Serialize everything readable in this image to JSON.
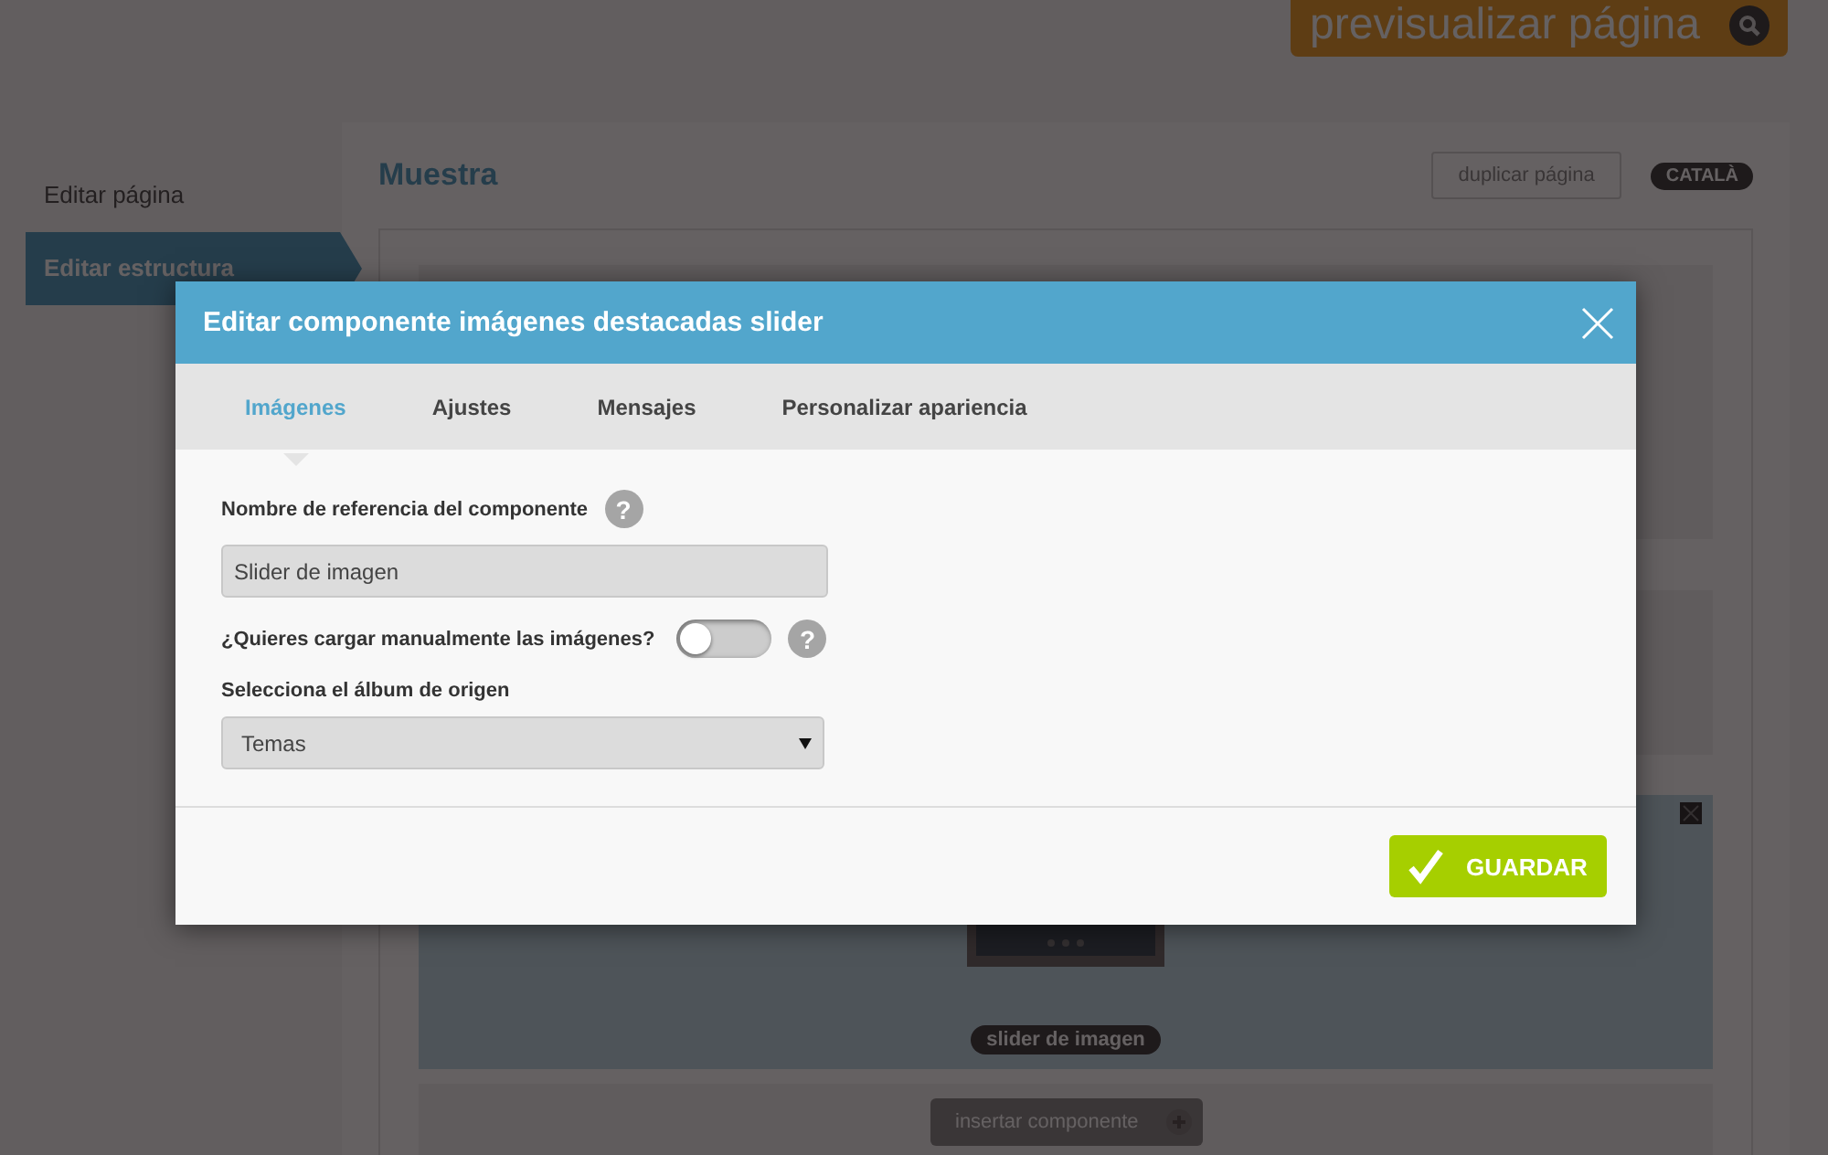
{
  "header": {
    "preview_button": "previsualizar página"
  },
  "sidebar": {
    "items": [
      {
        "label": "Editar página",
        "selected": false
      },
      {
        "label": "Editar estructura",
        "selected": true
      }
    ]
  },
  "page": {
    "title": "Muestra",
    "duplicate_button": "duplicar página",
    "language_badge": "CATALÀ",
    "slider_label": "slider de imagen",
    "insert_button": "insertar componente"
  },
  "modal": {
    "title": "Editar componente imágenes destacadas slider",
    "tabs": [
      {
        "label": "Imágenes",
        "selected": true
      },
      {
        "label": "Ajustes",
        "selected": false
      },
      {
        "label": "Mensajes",
        "selected": false
      },
      {
        "label": "Personalizar apariencia",
        "selected": false
      }
    ],
    "fields": [
      {
        "kind": "text",
        "label": "Nombre de referencia del componente",
        "help": "?",
        "value": "Slider de imagen"
      },
      {
        "kind": "toggle",
        "label": "¿Quieres cargar manualmente las imágenes?",
        "help": "?",
        "on": false
      },
      {
        "kind": "select",
        "label": "Selecciona el álbum de origen",
        "value": "Temas"
      }
    ],
    "save_button": "GUARDAR"
  }
}
